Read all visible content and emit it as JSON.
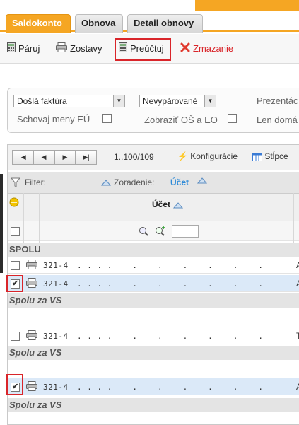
{
  "tabs": [
    "Saldokonto",
    "Obnova",
    "Detail obnovy"
  ],
  "toolbar": {
    "paruj": "Páruj",
    "zostavy": "Zostavy",
    "preuctuj": "Preúčtuj",
    "zmazanie": "Zmazanie"
  },
  "filters": {
    "doc_type": "Došlá faktúra",
    "pair_state": "Nevypárované",
    "prezentacia": "Prezentác",
    "schovaj_meny": "Schovaj meny EÚ",
    "zobrazit_os": "Zobraziť OŠ a EO",
    "len_doma": "Len domá"
  },
  "pager": {
    "range": "1..100/109",
    "konfiguracie": "Konfigurácie",
    "stlpce": "Stĺpce"
  },
  "filterbar": {
    "filter": "Filter:",
    "zoradenie": "Zoradenie:",
    "sort_field": "Účet"
  },
  "column": {
    "ucet": "Účet"
  },
  "groups": {
    "spolu": "SPOLU",
    "spolu_vs": "Spolu za VS"
  },
  "rows": [
    {
      "account": "321-4",
      "dots": ". . . .    .    .    .    .    .    .",
      "end": "A",
      "checked": false
    },
    {
      "account": "321-4",
      "dots": ". . . .    .    .    .    .    .    .",
      "end": "A",
      "checked": true
    },
    {
      "account": "321-4",
      "dots": ". . . .    .    .    .    .    .    .",
      "end": "T",
      "checked": false
    },
    {
      "account": "321-4",
      "dots": ". . . .    .    .    .    .    .    .",
      "end": "A",
      "checked": true
    }
  ]
}
